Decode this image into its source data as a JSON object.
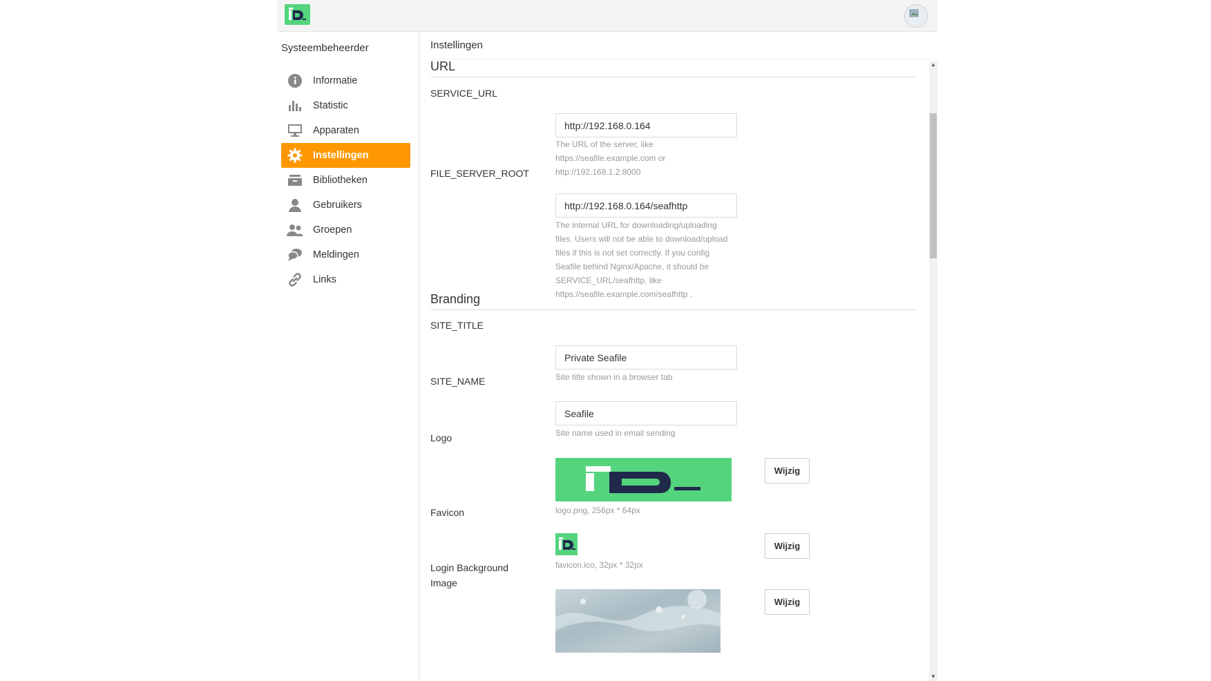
{
  "header": {
    "logo_icon": "site-logo-icon",
    "avatar_icon": "user-avatar-icon"
  },
  "sidebar": {
    "heading": "Systeembeheerder",
    "items": [
      {
        "label": "Informatie",
        "icon": "info-icon"
      },
      {
        "label": "Statistic",
        "icon": "bar-chart-icon"
      },
      {
        "label": "Apparaten",
        "icon": "monitor-icon"
      },
      {
        "label": "Instellingen",
        "icon": "gear-icon",
        "active": true
      },
      {
        "label": "Bibliotheken",
        "icon": "library-icon"
      },
      {
        "label": "Gebruikers",
        "icon": "user-icon"
      },
      {
        "label": "Groepen",
        "icon": "group-icon"
      },
      {
        "label": "Meldingen",
        "icon": "chat-icon"
      },
      {
        "label": "Links",
        "icon": "link-icon"
      }
    ]
  },
  "main": {
    "title": "Instellingen",
    "url_section": {
      "title": "URL",
      "service_url": {
        "label": "SERVICE_URL",
        "value": "http://192.168.0.164",
        "help": "The URL of the server, like https://seafile.example.com or http://192.168.1.2:8000"
      },
      "file_server_root": {
        "label": "FILE_SERVER_ROOT",
        "value": "http://192.168.0.164/seafhttp",
        "help": "The internal URL for downloading/uploading files. Users will not be able to download/upload files if this is not set correctly. If you config Seafile behind Nginx/Apache, it should be SERVICE_URL/seafhttp, like https://seafile.example.com/seafhttp ."
      }
    },
    "branding_section": {
      "title": "Branding",
      "site_title": {
        "label": "SITE_TITLE",
        "value": "Private Seafile",
        "help": "Site title shown in a browser tab"
      },
      "site_name": {
        "label": "SITE_NAME",
        "value": "Seafile",
        "help": "Site name used in email sending"
      },
      "logo": {
        "label": "Logo",
        "info": "logo.png, 256px * 64px",
        "button": "Wijzig"
      },
      "favicon": {
        "label": "Favicon",
        "info": "favicon.ico, 32px * 32px",
        "button": "Wijzig"
      },
      "login_bg": {
        "label": "Login Background Image",
        "button": "Wijzig"
      }
    }
  },
  "colors": {
    "accent": "#ff9800",
    "brand_green": "#55d47e",
    "brand_navy": "#1f2a4a"
  }
}
